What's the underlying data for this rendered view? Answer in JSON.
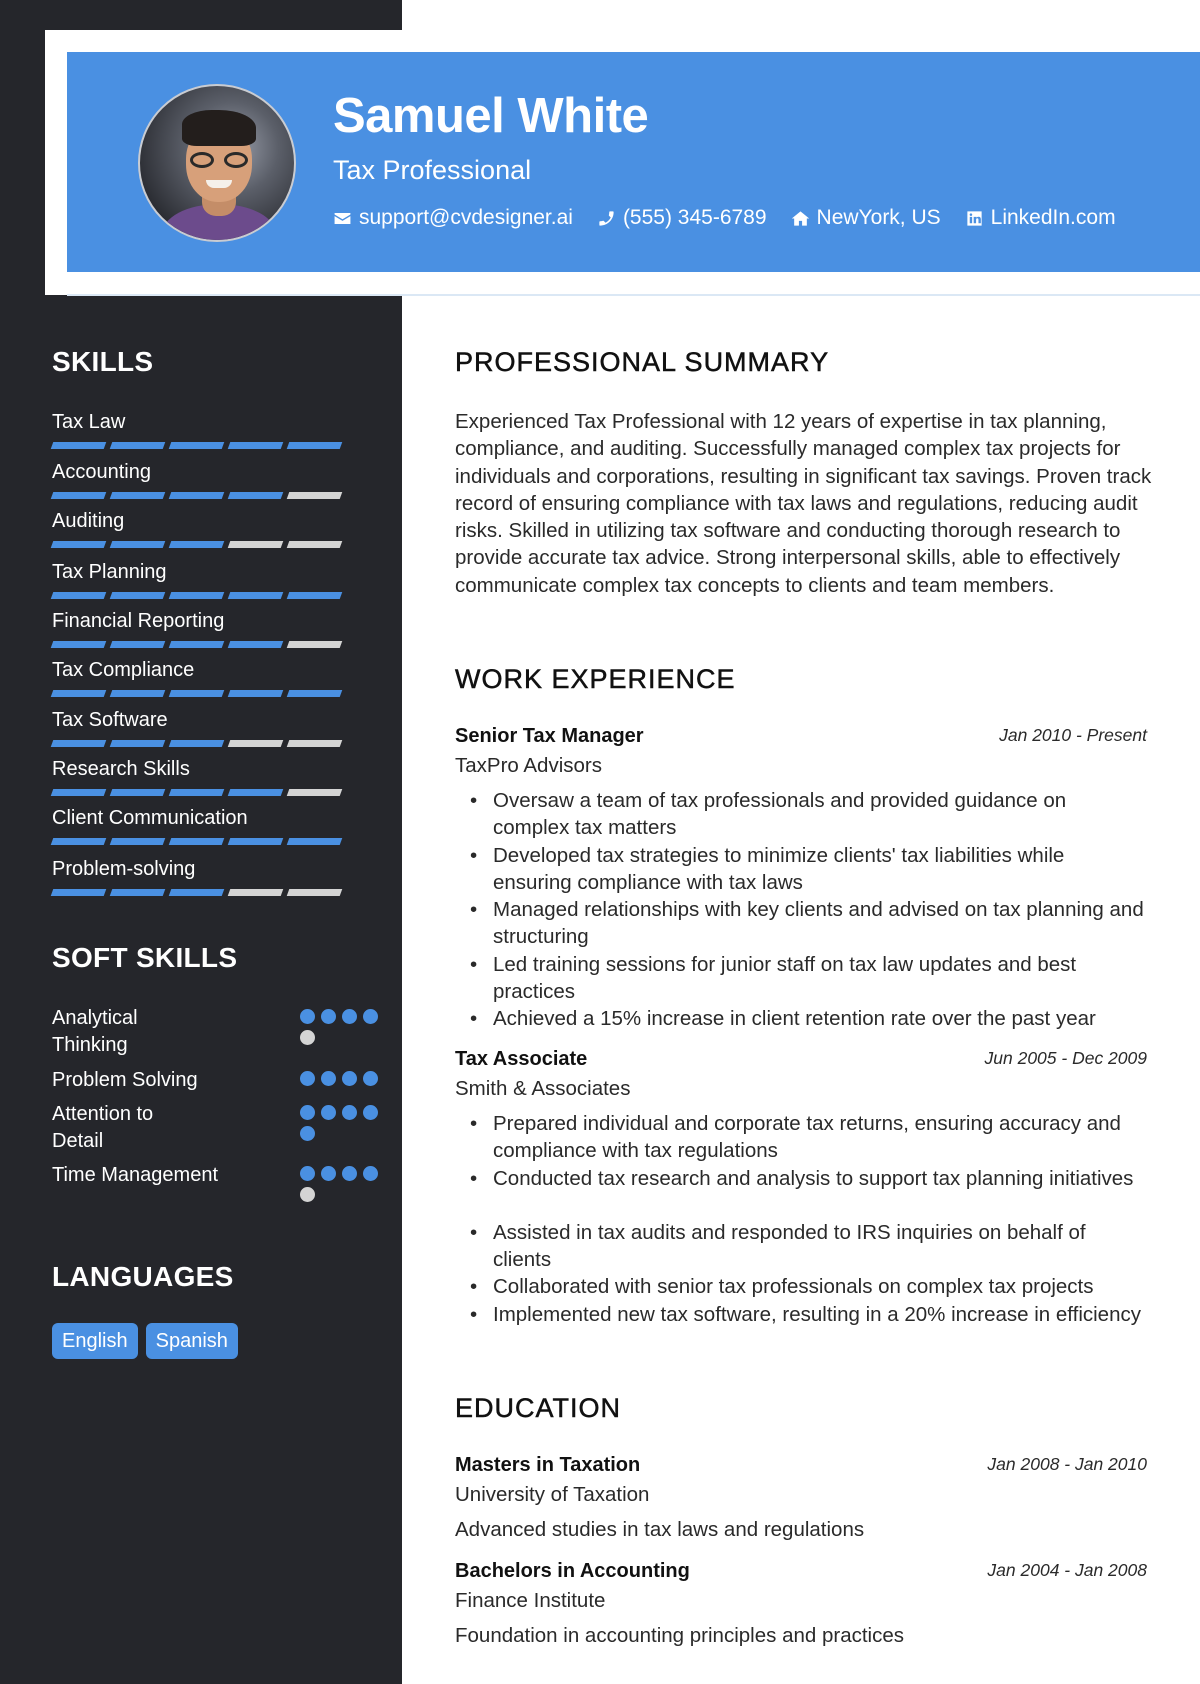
{
  "header": {
    "name": "Samuel White",
    "title": "Tax Professional",
    "contacts": [
      {
        "icon": "envelope-icon",
        "text": "support@cvdesigner.ai"
      },
      {
        "icon": "phone-icon",
        "text": "(555) 345-6789"
      },
      {
        "icon": "home-icon",
        "text": "NewYork, US"
      },
      {
        "icon": "linkedin-icon",
        "text": "LinkedIn.com"
      }
    ]
  },
  "colors": {
    "accent": "#4a90e2",
    "sidebar": "#25262b",
    "inactive": "#d4d4d4"
  },
  "sidebar": {
    "skills_title": "SKILLS",
    "skills": [
      {
        "label": "Tax Law",
        "level": 5,
        "max": 5
      },
      {
        "label": "Accounting",
        "level": 4,
        "max": 5
      },
      {
        "label": "Auditing",
        "level": 3,
        "max": 5
      },
      {
        "label": "Tax Planning",
        "level": 5,
        "max": 5
      },
      {
        "label": "Financial Reporting",
        "level": 4,
        "max": 5
      },
      {
        "label": "Tax Compliance",
        "level": 5,
        "max": 5
      },
      {
        "label": "Tax Software",
        "level": 3,
        "max": 5
      },
      {
        "label": "Research Skills",
        "level": 4,
        "max": 5
      },
      {
        "label": "Client Communication",
        "level": 5,
        "max": 5
      },
      {
        "label": "Problem-solving",
        "level": 3,
        "max": 5
      }
    ],
    "soft_skills_title": "SOFT SKILLS",
    "soft_skills": [
      {
        "label": "Analytical Thinking",
        "level": 4,
        "max": 5
      },
      {
        "label": "Problem Solving",
        "level": 4,
        "max": 4
      },
      {
        "label": "Attention to Detail",
        "level": 5,
        "max": 5
      },
      {
        "label": "Time Management",
        "level": 4,
        "max": 5
      }
    ],
    "languages_title": "LANGUAGES",
    "languages": [
      "English",
      "Spanish"
    ]
  },
  "main": {
    "summary_title": "PROFESSIONAL SUMMARY",
    "summary": "Experienced Tax Professional with 12 years of expertise in tax planning, compliance, and auditing. Successfully managed complex tax projects for individuals and corporations, resulting in significant tax savings. Proven track record of ensuring compliance with tax laws and regulations, reducing audit risks. Skilled in utilizing tax software and conducting thorough research to provide accurate tax advice. Strong interpersonal skills, able to effectively communicate complex tax concepts to clients and team members.",
    "experience_title": "WORK EXPERIENCE",
    "jobs": [
      {
        "role": "Senior Tax Manager",
        "date": "Jan 2010 - Present",
        "company": "TaxPro Advisors",
        "bullets": [
          "Oversaw a team of tax professionals and provided guidance on complex tax matters",
          "Developed tax strategies to minimize clients' tax liabilities while ensuring compliance with tax laws",
          "Managed relationships with key clients and advised on tax planning and structuring",
          "Led training sessions for junior staff on tax law updates and best practices",
          "Achieved a 15% increase in client retention rate over the past year"
        ]
      },
      {
        "role": "Tax Associate",
        "date": "Jun 2005 - Dec 2009",
        "company": "Smith & Associates",
        "bullets": [
          "Prepared individual and corporate tax returns, ensuring accuracy and compliance with tax regulations",
          "Conducted tax research and analysis to support tax planning initiatives",
          "Assisted in tax audits and responded to IRS inquiries on behalf of clients",
          "Collaborated with senior tax professionals on complex tax projects",
          "Implemented new tax software, resulting in a 20% increase in efficiency"
        ]
      }
    ],
    "education_title": "EDUCATION",
    "education": [
      {
        "degree": "Masters in Taxation",
        "date": "Jan 2008 - Jan 2010",
        "school": "University of Taxation",
        "description": "Advanced studies in tax laws and regulations"
      },
      {
        "degree": "Bachelors in Accounting",
        "date": "Jan 2004 - Jan 2008",
        "school": "Finance Institute",
        "description": "Foundation in accounting principles and practices"
      }
    ]
  }
}
